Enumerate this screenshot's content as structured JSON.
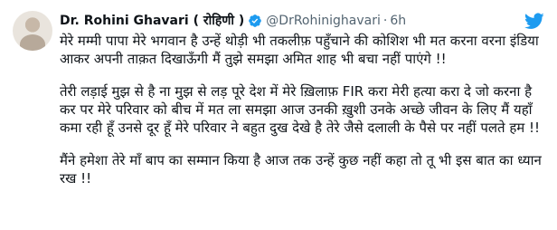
{
  "tweet": {
    "author_name": "Dr. Rohini Ghavari ( रोहिणी )",
    "handle": "@DrRohinighavari",
    "separator": "·",
    "timestamp": "6h",
    "verified_icon": "verified-badge-icon",
    "logo_icon": "twitter-bird-icon",
    "paragraphs": [
      "मेरे मम्मी पापा मेरे भगवान है उन्हें थोड़ी भी तकलीफ़ पहुँचाने की कोशिश भी मत करना वरना इंडिया आकर अपनी ताक़त दिखाऊँगी मैं तुझे समझा अमित शाह भी बचा नहीं पाएंगे !!",
      "तेरी लड़ाई मुझ से है ना मुझ से लड़ पूरे देश में मेरे ख़िलाफ़ FIR करा मेरी हत्या करा दे जो करना है कर पर मेरे परिवार को बीच में मत ला समझा आज उनकी ख़ुशी उनके अच्छे जीवन के लिए मैं यहाँ कमा रही हूँ उनसे दूर हूँ मेरे परिवार ने बहुत दुख देखे है तेरे जैसे दलाली के पैसे पर नहीं पलते हम !!",
      "मैंने हमेशा तेरे माँ बाप का सम्मान किया है आज तक उन्हें कुछ नहीं कहा तो तू भी इस बात का ध्यान रख !!"
    ]
  },
  "colors": {
    "text_primary": "#0f1419",
    "text_secondary": "#536471",
    "verified_blue": "#1d9bf0",
    "twitter_blue": "#1d9bf0",
    "background": "#ffffff"
  }
}
